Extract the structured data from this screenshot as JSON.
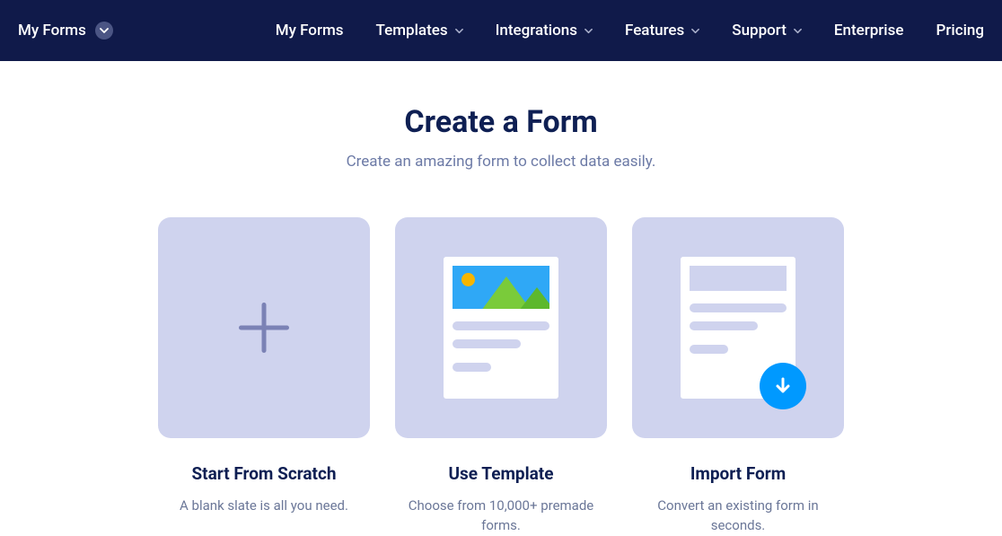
{
  "nav": {
    "left_label": "My Forms",
    "items": [
      {
        "label": "My Forms",
        "has_dropdown": false
      },
      {
        "label": "Templates",
        "has_dropdown": true
      },
      {
        "label": "Integrations",
        "has_dropdown": true
      },
      {
        "label": "Features",
        "has_dropdown": true
      },
      {
        "label": "Support",
        "has_dropdown": true
      },
      {
        "label": "Enterprise",
        "has_dropdown": false
      },
      {
        "label": "Pricing",
        "has_dropdown": false
      }
    ]
  },
  "page": {
    "title": "Create a Form",
    "subtitle": "Create an amazing form to collect data easily."
  },
  "cards": {
    "scratch": {
      "title": "Start From Scratch",
      "desc": "A blank slate is all you need."
    },
    "template": {
      "title": "Use Template",
      "desc": "Choose from 10,000+ premade forms."
    },
    "import": {
      "title": "Import Form",
      "desc": "Convert an existing form in seconds."
    }
  }
}
